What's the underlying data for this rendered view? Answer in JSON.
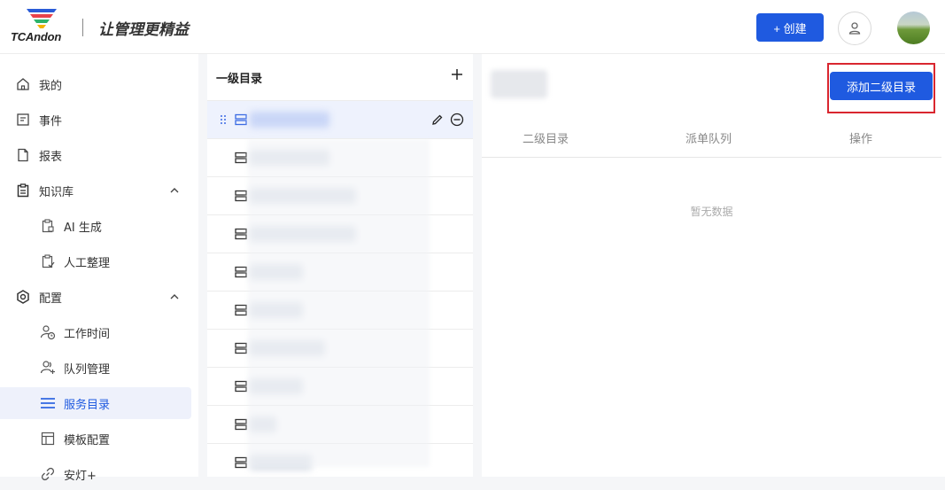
{
  "header": {
    "logo_text": "TCAndon",
    "slogan": "让管理更精益",
    "create_label": "+ 创建",
    "colors": {
      "primary": "#1f5ae0"
    }
  },
  "sidebar": {
    "items": [
      {
        "label": "我的",
        "icon": "home-icon",
        "level": "top"
      },
      {
        "label": "事件",
        "icon": "document-icon",
        "level": "top"
      },
      {
        "label": "报表",
        "icon": "file-icon",
        "level": "top"
      },
      {
        "label": "知识库",
        "icon": "clipboard-icon",
        "level": "top",
        "expanded": true
      },
      {
        "label": "AI 生成",
        "icon": "ai-doc-icon",
        "level": "sub"
      },
      {
        "label": "人工整理",
        "icon": "check-clipboard-icon",
        "level": "sub"
      },
      {
        "label": "配置",
        "icon": "hexagon-gear-icon",
        "level": "top",
        "expanded": true
      },
      {
        "label": "工作时间",
        "icon": "user-clock-icon",
        "level": "sub"
      },
      {
        "label": "队列管理",
        "icon": "users-add-icon",
        "level": "sub"
      },
      {
        "label": "服务目录",
        "icon": "list-icon",
        "level": "sub",
        "active": true
      },
      {
        "label": "模板配置",
        "icon": "layout-icon",
        "level": "sub"
      },
      {
        "label": "安灯+",
        "icon": "link-icon",
        "level": "sub"
      }
    ]
  },
  "catalog": {
    "header": "一级目录",
    "row_count": 10
  },
  "detail": {
    "add_button": "添加二级目录",
    "columns": [
      "二级目录",
      "派单队列",
      "操作"
    ],
    "empty_text": "暂无数据"
  }
}
